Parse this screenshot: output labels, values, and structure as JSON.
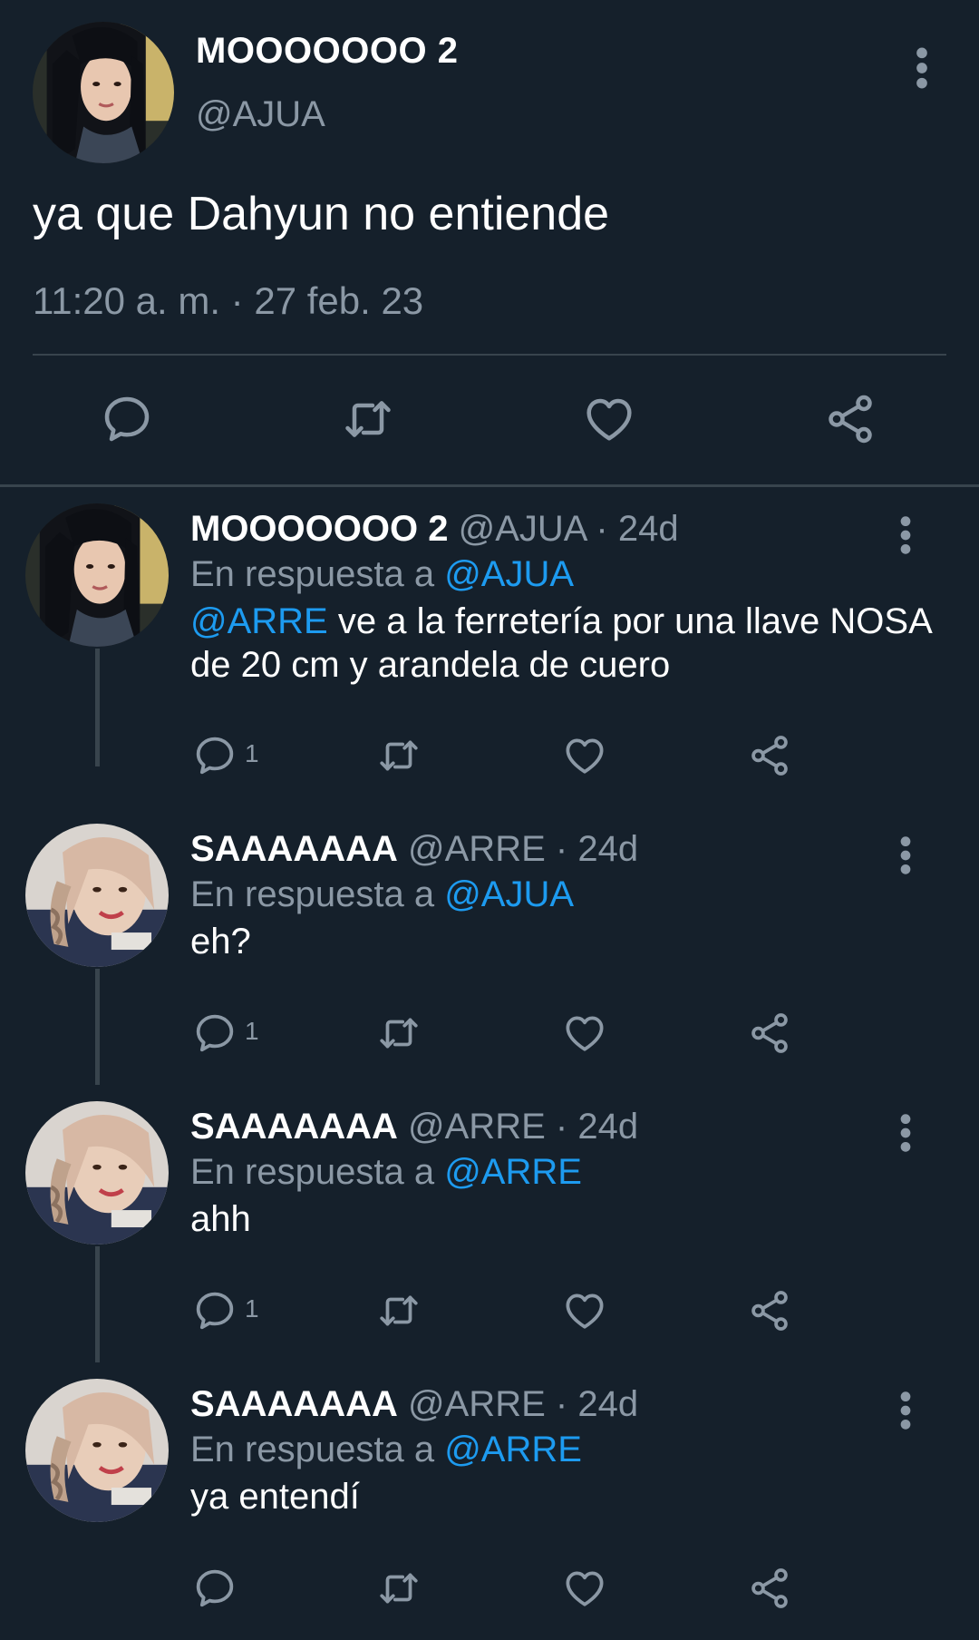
{
  "main_tweet": {
    "name": "MOOOOOOO 2",
    "handle": "@AJUA",
    "text": "ya que Dahyun no entiende",
    "timestamp": "11:20 a. m. · 27 feb. 23",
    "icons": {
      "more": "more-vertical-icon",
      "reply": "reply-icon",
      "retweet": "retweet-icon",
      "like": "heart-icon",
      "share": "share-icon"
    }
  },
  "replies": [
    {
      "name": "MOOOOOOO 2",
      "handle": "@AJUA",
      "separator": "·",
      "age": "24d",
      "replying_prefix": "En respuesta a",
      "replying_to": "@AJUA",
      "body_mention": "@ARRE",
      "body_text": " ve a la ferretería por una llave NOSA de 20 cm y arandela de cuero",
      "reply_count": "1"
    },
    {
      "name": "SAAAAAAA",
      "handle": "@ARRE",
      "separator": "·",
      "age": "24d",
      "replying_prefix": "En respuesta a",
      "replying_to": "@AJUA",
      "body_mention": "",
      "body_text": "eh?",
      "reply_count": "1"
    },
    {
      "name": "SAAAAAAA",
      "handle": "@ARRE",
      "separator": "·",
      "age": "24d",
      "replying_prefix": "En respuesta a",
      "replying_to": "@ARRE",
      "body_mention": "",
      "body_text": "ahh",
      "reply_count": "1"
    },
    {
      "name": "SAAAAAAA",
      "handle": "@ARRE",
      "separator": "·",
      "age": "24d",
      "replying_prefix": "En respuesta a",
      "replying_to": "@ARRE",
      "body_mention": "",
      "body_text": "ya entendí",
      "reply_count": ""
    }
  ],
  "colors": {
    "background": "#15202b",
    "text_primary": "#ffffff",
    "text_secondary": "#8b98a5",
    "accent": "#1d9bf0",
    "divider": "#38444d"
  }
}
